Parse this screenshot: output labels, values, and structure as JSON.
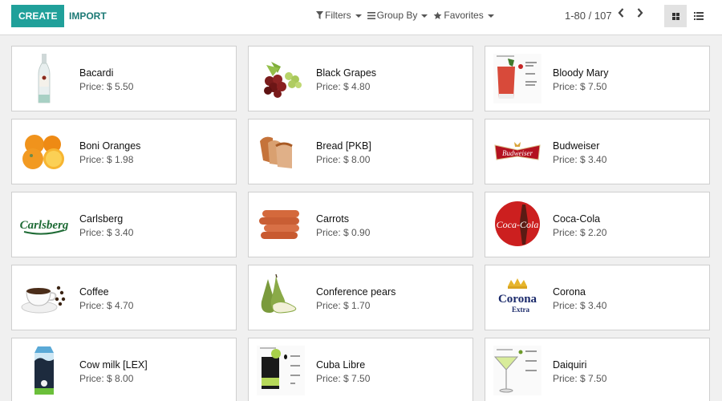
{
  "toolbar": {
    "create_label": "CREATE",
    "import_label": "IMPORT",
    "filters_label": "Filters",
    "groupby_label": "Group By",
    "favorites_label": "Favorites",
    "filters_icon": "funnel-icon",
    "groupby_icon": "bars-icon",
    "favorites_icon": "star-icon"
  },
  "pager": {
    "range": "1-80 / 107",
    "prev_icon": "chevron-left-icon",
    "next_icon": "chevron-right-icon"
  },
  "views": {
    "active": "kanban",
    "items": [
      "kanban",
      "list"
    ]
  },
  "colors": {
    "accent": "#20a09a",
    "accent_text": "#1d7a76"
  },
  "products": [
    {
      "name": "Bacardi",
      "price": "Price: $ 5.50",
      "image": "rum-bottle"
    },
    {
      "name": "Black Grapes",
      "price": "Price: $ 4.80",
      "image": "grapes"
    },
    {
      "name": "Bloody Mary",
      "price": "Price: $ 7.50",
      "image": "cocktail-red"
    },
    {
      "name": "Boni Oranges",
      "price": "Price: $ 1.98",
      "image": "oranges"
    },
    {
      "name": "Bread [PKB]",
      "price": "Price: $ 8.00",
      "image": "bread"
    },
    {
      "name": "Budweiser",
      "price": "Price: $ 3.40",
      "image": "budweiser-logo"
    },
    {
      "name": "Carlsberg",
      "price": "Price: $ 3.40",
      "image": "carlsberg-logo"
    },
    {
      "name": "Carrots",
      "price": "Price: $ 0.90",
      "image": "carrots"
    },
    {
      "name": "Coca-Cola",
      "price": "Price: $ 2.20",
      "image": "cocacola-logo"
    },
    {
      "name": "Coffee",
      "price": "Price: $ 4.70",
      "image": "coffee-cup"
    },
    {
      "name": "Conference pears",
      "price": "Price: $ 1.70",
      "image": "pears"
    },
    {
      "name": "Corona",
      "price": "Price: $ 3.40",
      "image": "corona-logo"
    },
    {
      "name": "Cow milk [LEX]",
      "price": "Price: $ 8.00",
      "image": "milk-carton"
    },
    {
      "name": "Cuba Libre",
      "price": "Price: $ 7.50",
      "image": "cocktail-dark"
    },
    {
      "name": "Daiquiri",
      "price": "Price: $ 7.50",
      "image": "cocktail-martini"
    }
  ]
}
